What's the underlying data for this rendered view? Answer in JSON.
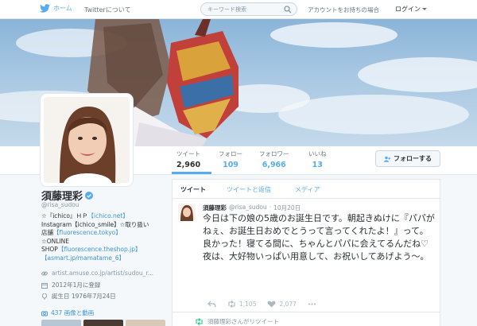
{
  "nav": {
    "home_label": "ホーム",
    "about_label": "Twitterについて",
    "search_placeholder": "キーワード検索",
    "login_prompt": "アカウントをお持ちの場合",
    "login_label": "ログイン"
  },
  "profile_nav": {
    "stats": [
      {
        "label": "ツイート",
        "value": "2,960"
      },
      {
        "label": "フォロー",
        "value": "109"
      },
      {
        "label": "フォロワー",
        "value": "6,966"
      },
      {
        "label": "いいね",
        "value": "13"
      }
    ],
    "follow_label": "フォローする"
  },
  "profile": {
    "name": "須藤理彩",
    "handle": "@risa_sudou",
    "bio_lines": [
      {
        "parts": [
          [
            "☆『ichico』ＨＰ",
            false
          ],
          [
            "【ichico.net】",
            true
          ]
        ]
      },
      {
        "parts": [
          [
            "Instagram【ichico_smile】☆取り扱い",
            false
          ]
        ]
      },
      {
        "parts": [
          [
            "店舗",
            false
          ],
          [
            "【fluorescence.tokyo】",
            true
          ]
        ]
      },
      {
        "parts": [
          [
            "☆ONLINE",
            false
          ]
        ]
      },
      {
        "parts": [
          [
            "SHOP",
            false
          ],
          [
            "【fluorescence.theshop.jp】",
            true
          ]
        ]
      },
      {
        "parts": [
          [
            "【asmart.jp/mamatame_6】",
            true
          ]
        ]
      }
    ],
    "website": "artist.amuse.co.jp/artist/sudou_r...",
    "joined": "2012年1月に登録",
    "birthday": "誕生日 1976年7月24日",
    "media_label": "437 画像と動画"
  },
  "timeline": {
    "tabs": [
      "ツイート",
      "ツイートと返信",
      "メディア"
    ],
    "tweet": {
      "author": "須藤理彩",
      "handle": "@risa_sudou",
      "date": "10月20日",
      "text": "今日は下の娘の5歳のお誕生日です。朝起きぬけに『パパがねぇ、お誕生日おめでとうって言ってくれたよ！』って。良かった！寝てる間に、ちゃんとパパに会えてるんだね♡夜は、大好物いっぱい用意して、お祝いしてあげよう〜。",
      "retweets": "1,105",
      "likes": "2,077"
    },
    "retweet_note": "須藤理彩さんがリツイート"
  },
  "colors": {
    "accent": "#55acee",
    "link": "#3b94d9",
    "text": "#292f33",
    "muted": "#8899a6",
    "border": "#e1e8ed"
  },
  "icons": [
    "twitter-bird-icon",
    "search-icon",
    "chevron-down-icon",
    "follow-person-icon",
    "verified-badge-icon",
    "link-icon",
    "calendar-icon",
    "balloon-icon",
    "camera-icon",
    "reply-icon",
    "retweet-icon",
    "heart-icon",
    "more-icon"
  ]
}
